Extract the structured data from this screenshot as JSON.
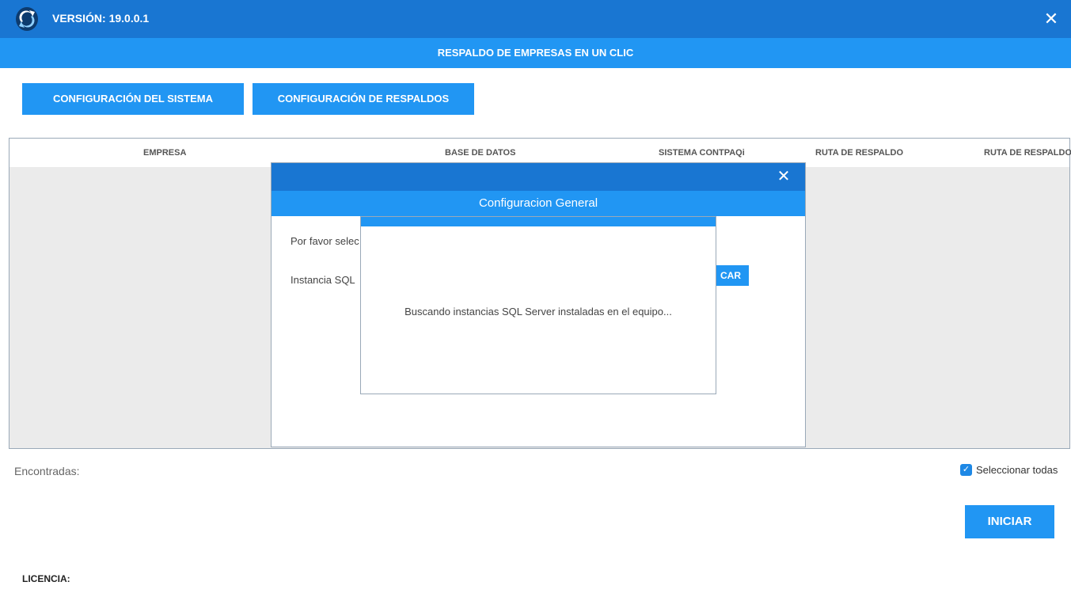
{
  "window": {
    "version": "VERSIÓN: 19.0.0.1",
    "close_glyph": "✕",
    "logo_icon": "sync-logo-icon"
  },
  "header": {
    "subtitle": "RESPALDO DE EMPRESAS EN UN CLIC"
  },
  "toolbar": {
    "system_config_label": "CONFIGURACIÓN DEL SISTEMA",
    "backup_config_label": "CONFIGURACIÓN DE RESPALDOS"
  },
  "table": {
    "columns": [
      "EMPRESA",
      "BASE DE DATOS",
      "SISTEMA CONTPAQi",
      "RUTA DE RESPALDO",
      "RUTA DE RESPALDO"
    ]
  },
  "footer": {
    "found_label": "Encontradas:",
    "select_all_label": "Seleccionar todas",
    "select_all_checked": true,
    "start_label": "INICIAR",
    "license_label": "LICENCIA:"
  },
  "dialog": {
    "close_glyph": "✕",
    "title": "Configuracion General",
    "prompt_text": "Por favor selec",
    "sql_label": "Instancia SQL",
    "button_label": "CAR"
  },
  "popup": {
    "message": "Buscando instancias SQL Server instaladas en el equipo..."
  },
  "colors": {
    "titlebar": "#1976d2",
    "accent": "#2196f3",
    "grid_body": "#ebebeb"
  }
}
